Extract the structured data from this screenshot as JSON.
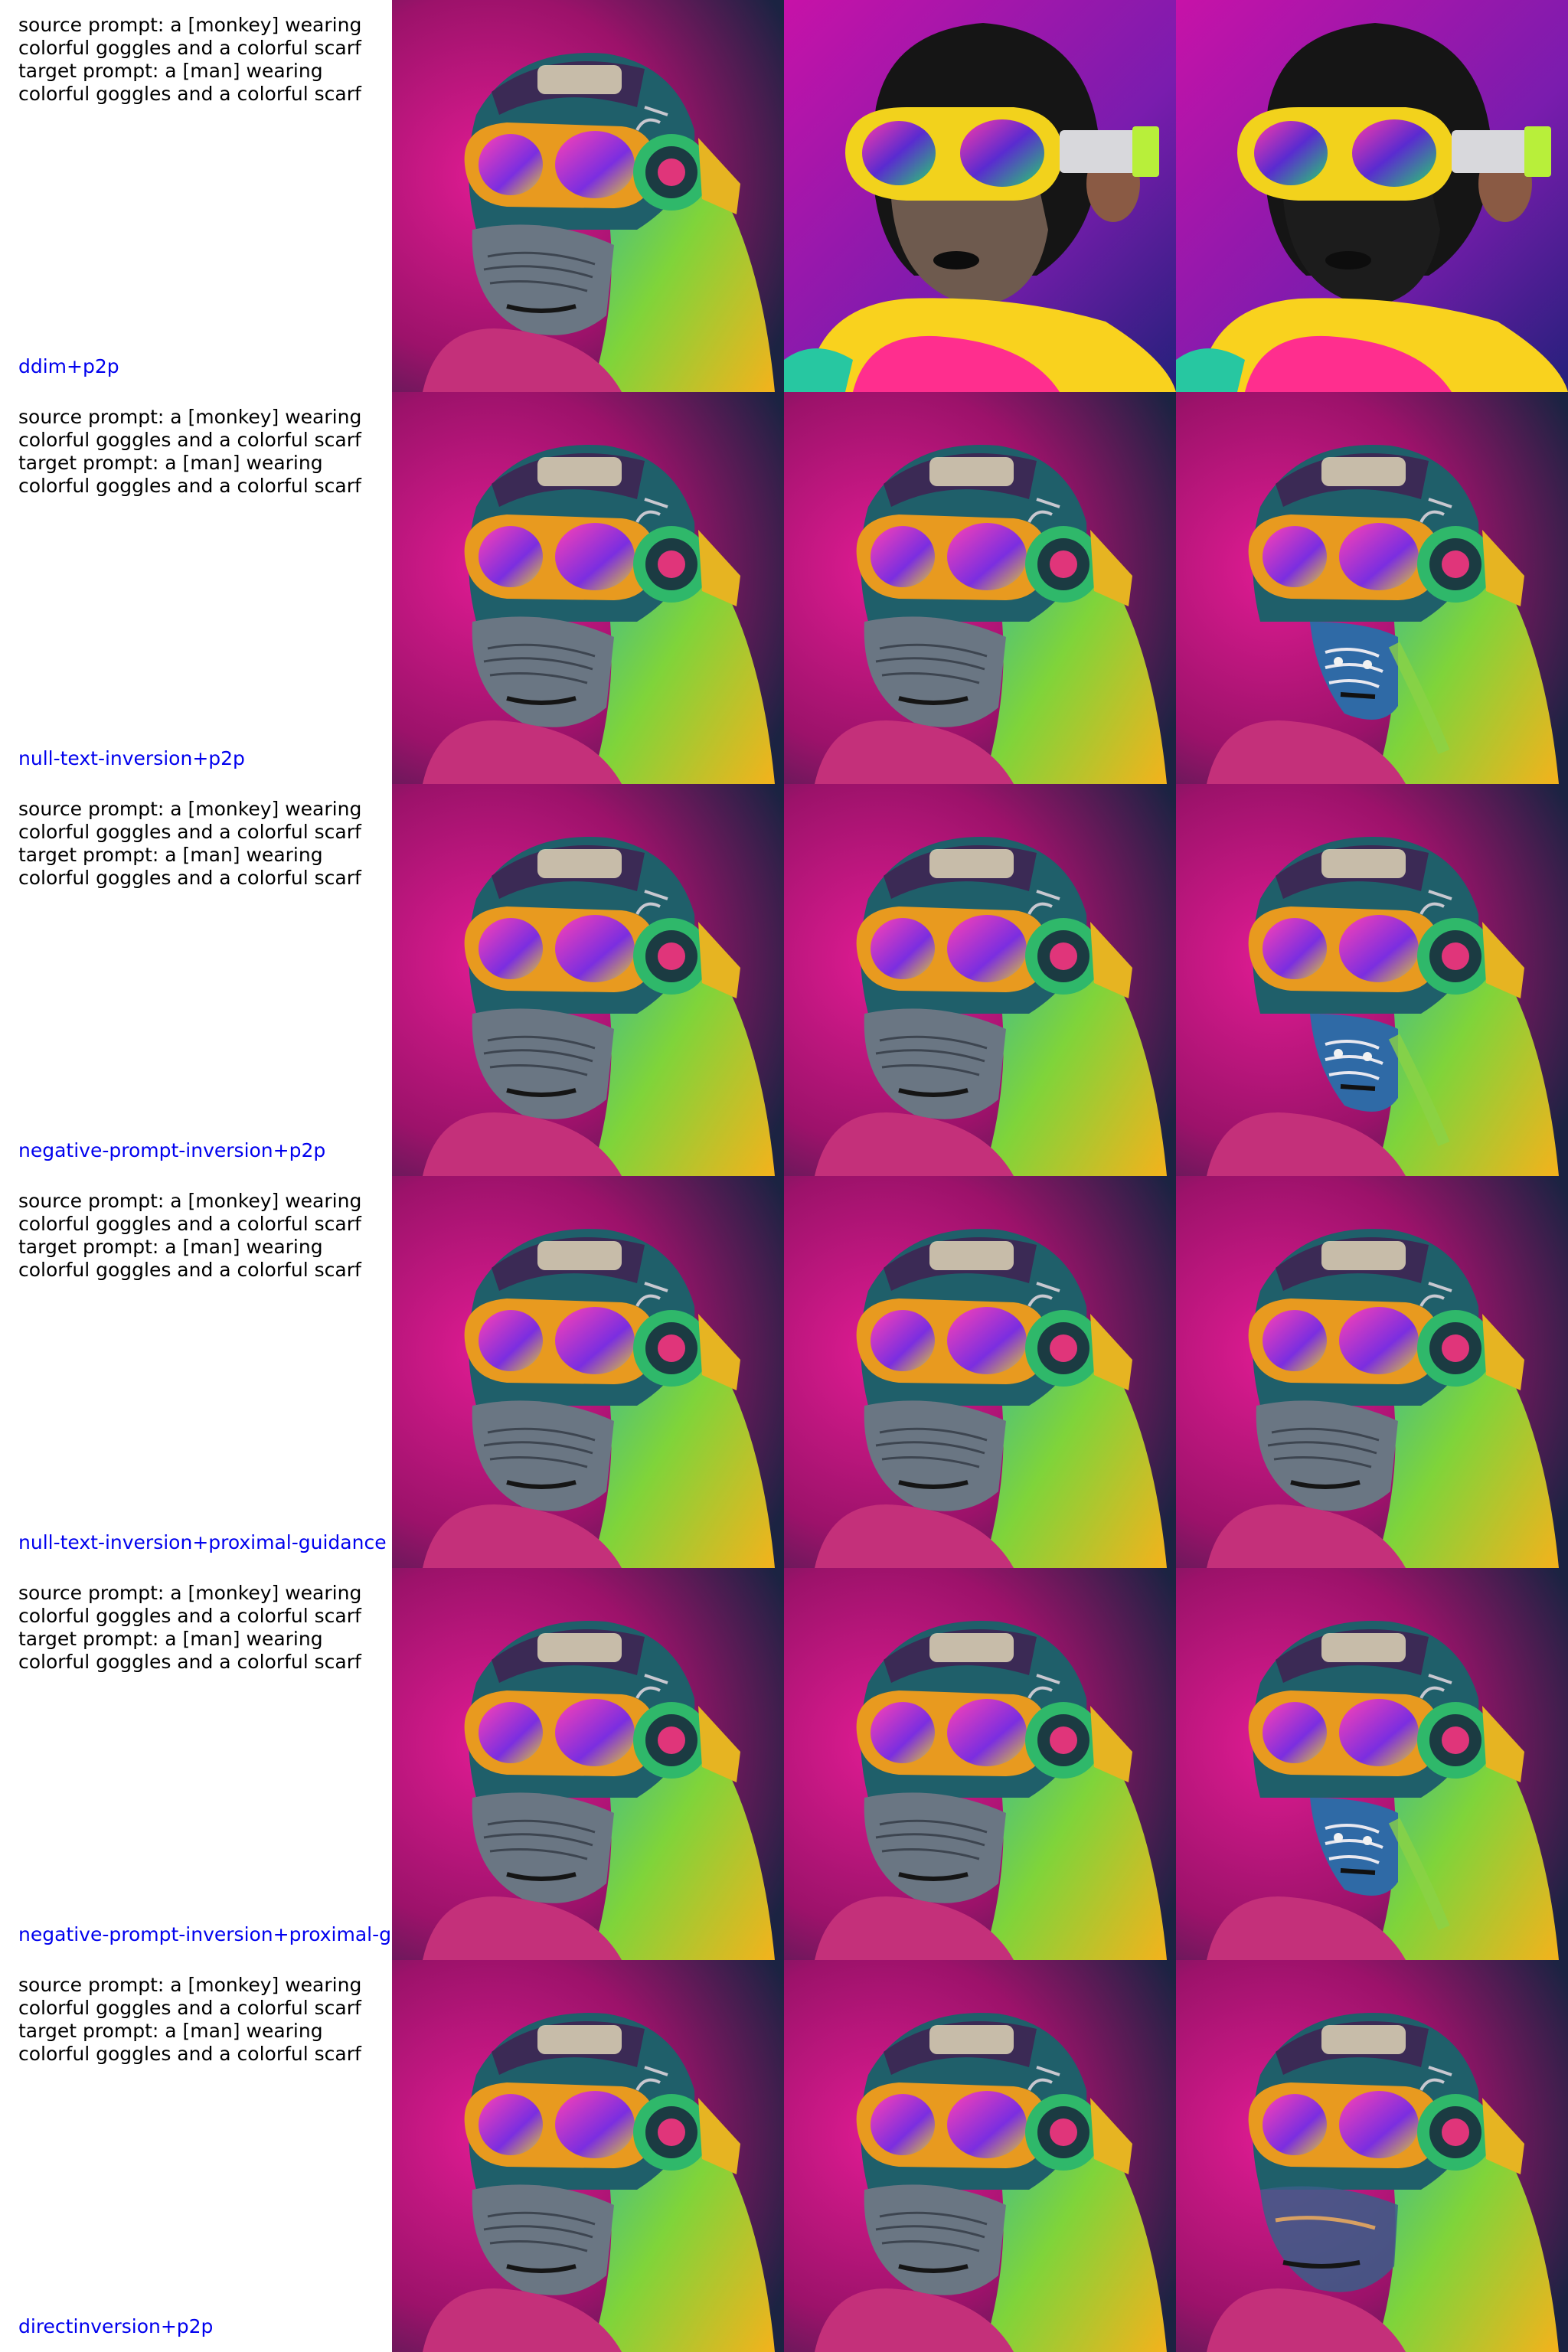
{
  "rows": [
    {
      "prompt": "source prompt: a [monkey] wearing\ncolorful goggles and a colorful scarf\ntarget prompt: a [man] wearing\ncolorful goggles and a colorful scarf",
      "method": "ddim+p2p",
      "images": [
        "source-monkey",
        "ddim-reconstruction",
        "ddim-edit"
      ]
    },
    {
      "prompt": "source prompt: a [monkey] wearing\ncolorful goggles and a colorful scarf\ntarget prompt: a [man] wearing\ncolorful goggles and a colorful scarf",
      "method": "null-text-inversion+p2p",
      "images": [
        "source-monkey",
        "reconstruction",
        "edit-masked"
      ]
    },
    {
      "prompt": "source prompt: a [monkey] wearing\ncolorful goggles and a colorful scarf\ntarget prompt: a [man] wearing\ncolorful goggles and a colorful scarf",
      "method": "negative-prompt-inversion+p2p",
      "images": [
        "source-monkey",
        "reconstruction",
        "edit-masked"
      ]
    },
    {
      "prompt": "source prompt: a [monkey] wearing\ncolorful goggles and a colorful scarf\ntarget prompt: a [man] wearing\ncolorful goggles and a colorful scarf",
      "method": "null-text-inversion+proximal-guidance",
      "images": [
        "source-monkey",
        "reconstruction",
        "edit-subtle"
      ]
    },
    {
      "prompt": "source prompt: a [monkey] wearing\ncolorful goggles and a colorful scarf\ntarget prompt: a [man] wearing\ncolorful goggles and a colorful scarf",
      "method": "negative-prompt-inversion+proximal-g",
      "images": [
        "source-monkey",
        "reconstruction",
        "edit-masked"
      ]
    },
    {
      "prompt": "source prompt: a [monkey] wearing\ncolorful goggles and a colorful scarf\ntarget prompt: a [man] wearing\ncolorful goggles and a colorful scarf",
      "method": "directinversion+p2p",
      "images": [
        "source-monkey",
        "reconstruction",
        "edit-blended"
      ]
    }
  ],
  "colors": {
    "label_blue": "#0000ee",
    "text_black": "#000000",
    "bg_magenta": "#c4157e",
    "bg_navy": "#1a2140"
  }
}
